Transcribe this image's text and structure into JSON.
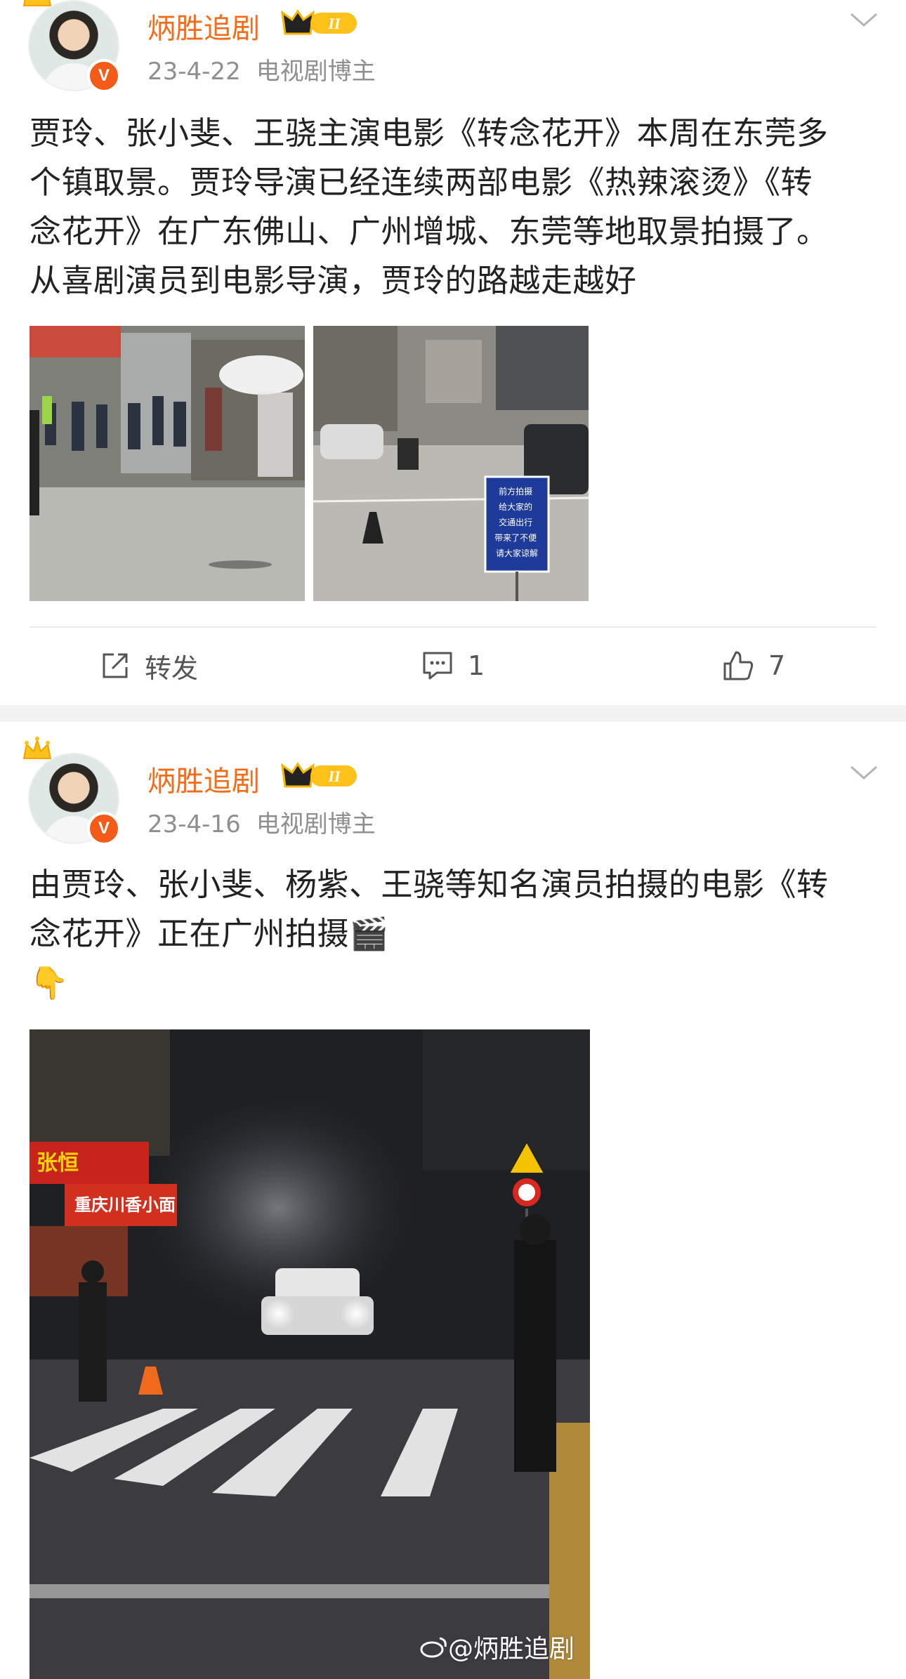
{
  "posts": [
    {
      "author": "炳胜追剧",
      "level": "II",
      "date": "23-4-22",
      "role": "电视剧博主",
      "text_lines": [
        "贾玲、张小斐、王骁主演电影《转念花开》本周在东莞多",
        "个镇取景。贾玲导演已经连续两部电影《热辣滚烫》《转",
        "念花开》在广东佛山、广州增城、东莞等地取景拍摄了。",
        "从喜剧演员到电影导演，贾玲的路越走越好"
      ],
      "image_sign_text": [
        "前方拍摄",
        "给大家的",
        "交通出行",
        "带来了不便",
        "请大家谅解"
      ],
      "actions": {
        "repost_label": "转发",
        "comment_count": "1",
        "like_count": "7"
      }
    },
    {
      "author": "炳胜追剧",
      "level": "II",
      "date": "23-4-16",
      "role": "电视剧博主",
      "text_lines": [
        "由贾玲、张小斐、杨紫、王骁等知名演员拍摄的电影《转",
        "念花开》正在广州拍摄🎬",
        "👇"
      ],
      "image_sign_text": [
        "张恒",
        "重庆川香小面"
      ],
      "watermark": "@炳胜追剧"
    }
  ],
  "colors": {
    "author_name": "#f56b16",
    "meta_text": "#8f8f8f",
    "verified_badge": "#f45a18",
    "level_badge": "#ffb400",
    "separator": "#f2f2f2"
  },
  "icons": {
    "repost": "repost-icon",
    "comment": "comment-icon",
    "like": "thumbs-up-icon",
    "menu": "chevron-down-icon",
    "crown": "crown-icon",
    "verified": "verified-v-icon"
  }
}
